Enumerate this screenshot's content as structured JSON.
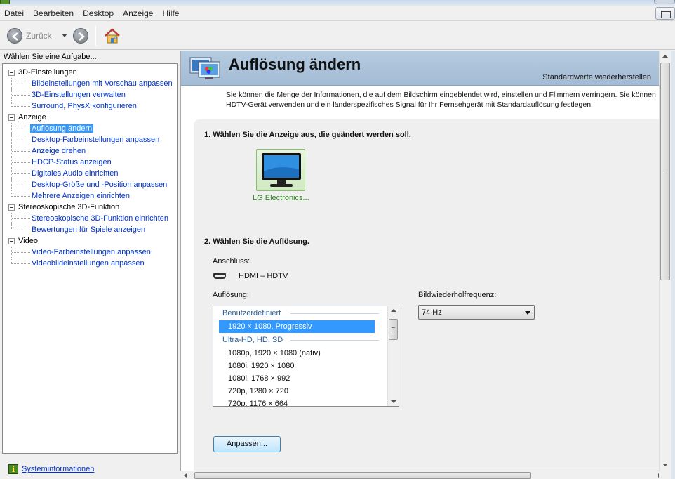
{
  "menu": {
    "items": [
      "Datei",
      "Bearbeiten",
      "Desktop",
      "Anzeige",
      "Hilfe"
    ]
  },
  "toolbar": {
    "back_label": "Zurück"
  },
  "left": {
    "header": "Wählen Sie eine Aufgabe...",
    "tree": [
      {
        "label": "3D-Einstellungen",
        "items": [
          "Bildeinstellungen mit Vorschau anpassen",
          "3D-Einstellungen verwalten",
          "Surround, PhysX konfigurieren"
        ]
      },
      {
        "label": "Anzeige",
        "items": [
          "Auflösung ändern",
          "Desktop-Farbeinstellungen anpassen",
          "Anzeige drehen",
          "HDCP-Status anzeigen",
          "Digitales Audio einrichten",
          "Desktop-Größe und -Position anpassen",
          "Mehrere Anzeigen einrichten"
        ]
      },
      {
        "label": "Stereoskopische 3D-Funktion",
        "items": [
          "Stereoskopische 3D-Funktion einrichten",
          "Bewertungen für Spiele anzeigen"
        ]
      },
      {
        "label": "Video",
        "items": [
          "Video-Farbeinstellungen anpassen",
          "Videobildeinstellungen anpassen"
        ]
      }
    ],
    "selected_item": "Auflösung ändern",
    "sysinfo_link": "Systeminformationen"
  },
  "main": {
    "title": "Auflösung ändern",
    "reset_link": "Standardwerte wiederherstellen",
    "intro_line1": "Sie können die Menge der Informationen, die auf dem Bildschirm eingeblendet wird, einstellen und Flimmern verringern. Sie können",
    "intro_line2": "HDTV-Gerät verwenden und ein länderspezifisches Signal für Ihr Fernsehgerät mit Standardauflösung festlegen.",
    "section1_title": "1. Wählen Sie die Anzeige aus, die geändert werden soll.",
    "monitor_label": "LG Electronics...",
    "section2_title": "2. Wählen Sie die Auflösung.",
    "connection_label": "Anschluss:",
    "connection_value": "HDMI – HDTV",
    "resolution_label": "Auflösung:",
    "refresh_label": "Bildwiederholfrequenz:",
    "refresh_value": "74 Hz",
    "resolution_list": {
      "group1": "Benutzerdefiniert",
      "selected": "1920 × 1080, Progressiv",
      "group2": "Ultra-HD, HD, SD",
      "rows": [
        "1080p, 1920 × 1080 (nativ)",
        "1080i, 1920 × 1080",
        "1080i, 1768 × 992",
        "720p, 1280 × 720",
        "720p, 1176 × 664"
      ]
    },
    "customize_button": "Anpassen..."
  }
}
